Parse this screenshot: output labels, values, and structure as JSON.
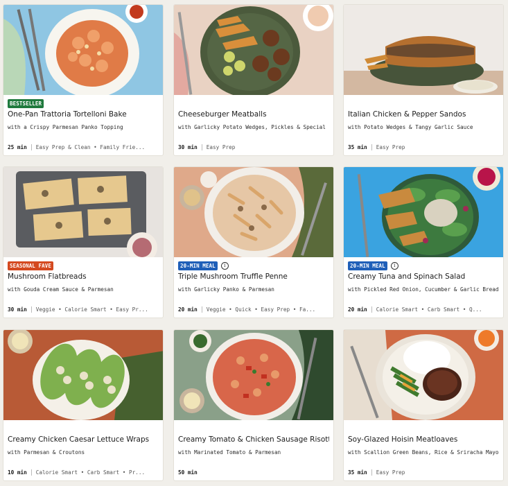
{
  "colors": {
    "bestseller": "#1f7a3d",
    "seasonal": "#d4491f",
    "quick": "#1f5fb8"
  },
  "cards": [
    {
      "badge": "BESTSELLER",
      "title": "One-Pan Trattoria Tortelloni Bake",
      "subtitle": "with a Crispy Parmesan Panko Topping",
      "time": "25 min",
      "tags": "Easy Prep & Clean • Family Frie..."
    },
    {
      "badge": "",
      "title": "Cheeseburger Meatballs",
      "subtitle": "with Garlicky Potato Wedges, Pickles & Special Sauce",
      "time": "30 min",
      "tags": "Easy Prep"
    },
    {
      "badge": "",
      "title": "Italian Chicken & Pepper Sandos",
      "subtitle": "with Potato Wedges & Tangy Garlic Sauce",
      "time": "35 min",
      "tags": "Easy Prep"
    },
    {
      "badge": "SEASONAL FAVE",
      "title": "Mushroom Flatbreads",
      "subtitle": "with Gouda Cream Sauce & Parmesan",
      "time": "30 min",
      "tags": "Veggie • Calorie Smart • Easy Pr..."
    },
    {
      "badge": "20-MIN MEAL",
      "title": "Triple Mushroom Truffle Penne",
      "subtitle": "with Garlicky Panko & Parmesan",
      "time": "20 min",
      "tags": "Veggie • Quick • Easy Prep • Fa..."
    },
    {
      "badge": "20-MIN MEAL",
      "title": "Creamy Tuna and Spinach Salad",
      "subtitle": "with Pickled Red Onion, Cucumber & Garlic Bread",
      "time": "20 min",
      "tags": "Calorie Smart • Carb Smart • Q..."
    },
    {
      "badge": "",
      "title": "Creamy Chicken Caesar Lettuce Wraps",
      "subtitle": "with Parmesan & Croutons",
      "time": "10 min",
      "tags": "Calorie Smart • Carb Smart • Pr..."
    },
    {
      "badge": "",
      "title": "Creamy Tomato & Chicken Sausage Risotto",
      "subtitle": "with Marinated Tomato & Parmesan",
      "time": "50 min",
      "tags": ""
    },
    {
      "badge": "",
      "title": "Soy-Glazed Hoisin Meatloaves",
      "subtitle": "with Scallion Green Beans, Rice & Sriracha Mayo",
      "time": "35 min",
      "tags": "Easy Prep"
    }
  ]
}
